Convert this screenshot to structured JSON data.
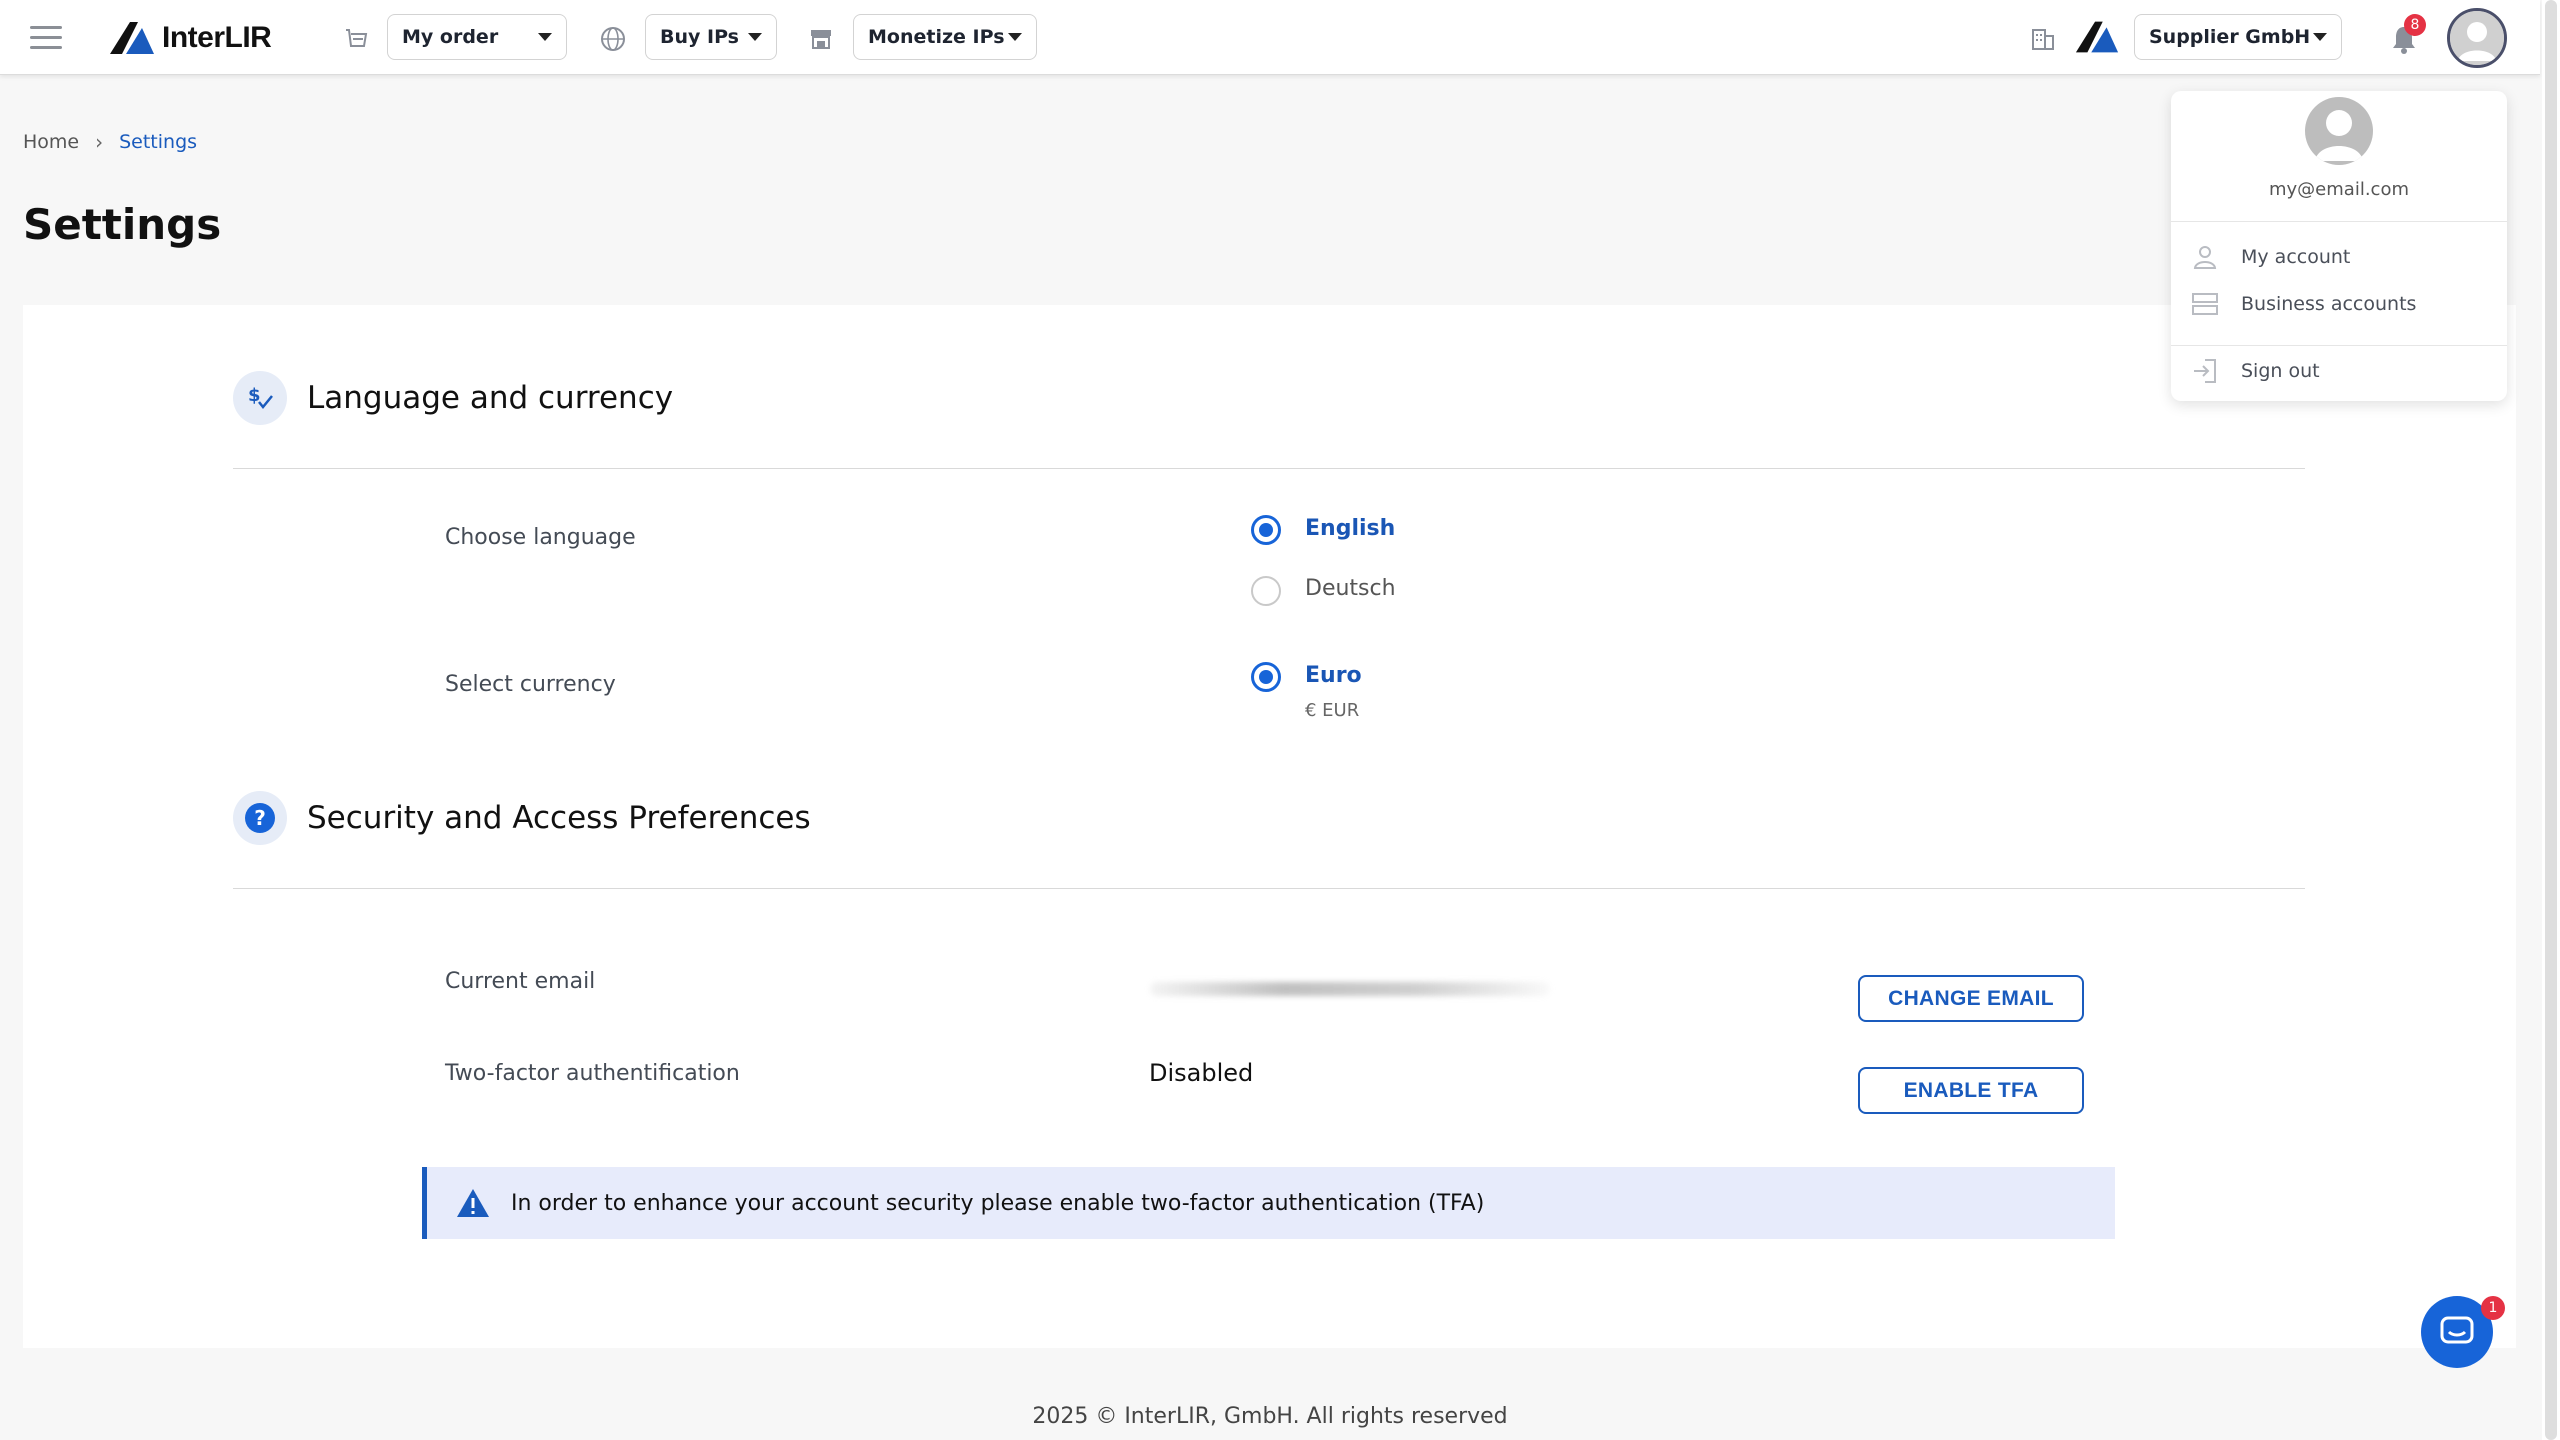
{
  "header": {
    "logo_text": "InterLIR",
    "order_dropdown": "My order",
    "buy_dropdown": "Buy IPs",
    "monetize_dropdown": "Monetize IPs",
    "company_dropdown": "Supplier GmbH",
    "notification_count": "8"
  },
  "breadcrumb": {
    "home": "Home",
    "current": "Settings"
  },
  "page": {
    "title": "Settings"
  },
  "language_section": {
    "title": "Language and currency",
    "choose_language_label": "Choose language",
    "languages": [
      {
        "label": "English",
        "selected": true
      },
      {
        "label": "Deutsch",
        "selected": false
      }
    ],
    "select_currency_label": "Select currency",
    "currency": {
      "label": "Euro",
      "code": "€ EUR",
      "selected": true
    }
  },
  "security_section": {
    "title": "Security and Access Preferences",
    "current_email_label": "Current email",
    "change_email_button": "CHANGE EMAIL",
    "tfa_label": "Two-factor authentification",
    "tfa_value": "Disabled",
    "enable_tfa_button": "ENABLE TFA",
    "alert_text": "In order to enhance your account security please enable two-factor authentication (TFA)"
  },
  "user_menu": {
    "email": "my@email.com",
    "items": [
      {
        "label": "My account",
        "icon": "user-icon"
      },
      {
        "label": "Business accounts",
        "icon": "business-accounts-icon"
      },
      {
        "label": "Sign out",
        "icon": "sign-out-icon"
      }
    ]
  },
  "chat": {
    "badge_count": "1"
  },
  "footer": {
    "text": "2025 © InterLIR, GmbH. All rights reserved"
  },
  "colors": {
    "accent": "#1764d8",
    "link": "#1a5bbd",
    "badge": "#e53244",
    "alert_bg": "#e7ebfb"
  }
}
